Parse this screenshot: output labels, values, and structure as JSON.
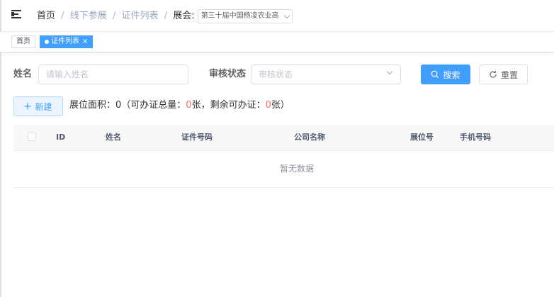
{
  "breadcrumb": {
    "home": "首页",
    "offline": "线下参展",
    "list": "证件列表",
    "expo_label": "展会:",
    "expo_value": "第三十届中国杨凌农业高"
  },
  "tags": {
    "home": "首页",
    "active": "证件列表",
    "close": "×"
  },
  "filters": {
    "name_label": "姓名",
    "name_placeholder": "请输入姓名",
    "status_label": "审核状态",
    "status_placeholder": "审核状态",
    "search_label": "搜索",
    "reset_label": "重置"
  },
  "toolbar": {
    "new_label": "新建",
    "area_prefix": "展位面积：0（可办证总量：",
    "total_value": "0",
    "area_mid": "张，剩余可办证：",
    "remain_value": "0",
    "area_suffix": "张）"
  },
  "table": {
    "columns": [
      "ID",
      "姓名",
      "证件号码",
      "公司名称",
      "展位号",
      "手机号码"
    ],
    "empty_text": "暂无数据"
  },
  "colors": {
    "primary": "#409eff",
    "danger": "#f56c6c"
  }
}
